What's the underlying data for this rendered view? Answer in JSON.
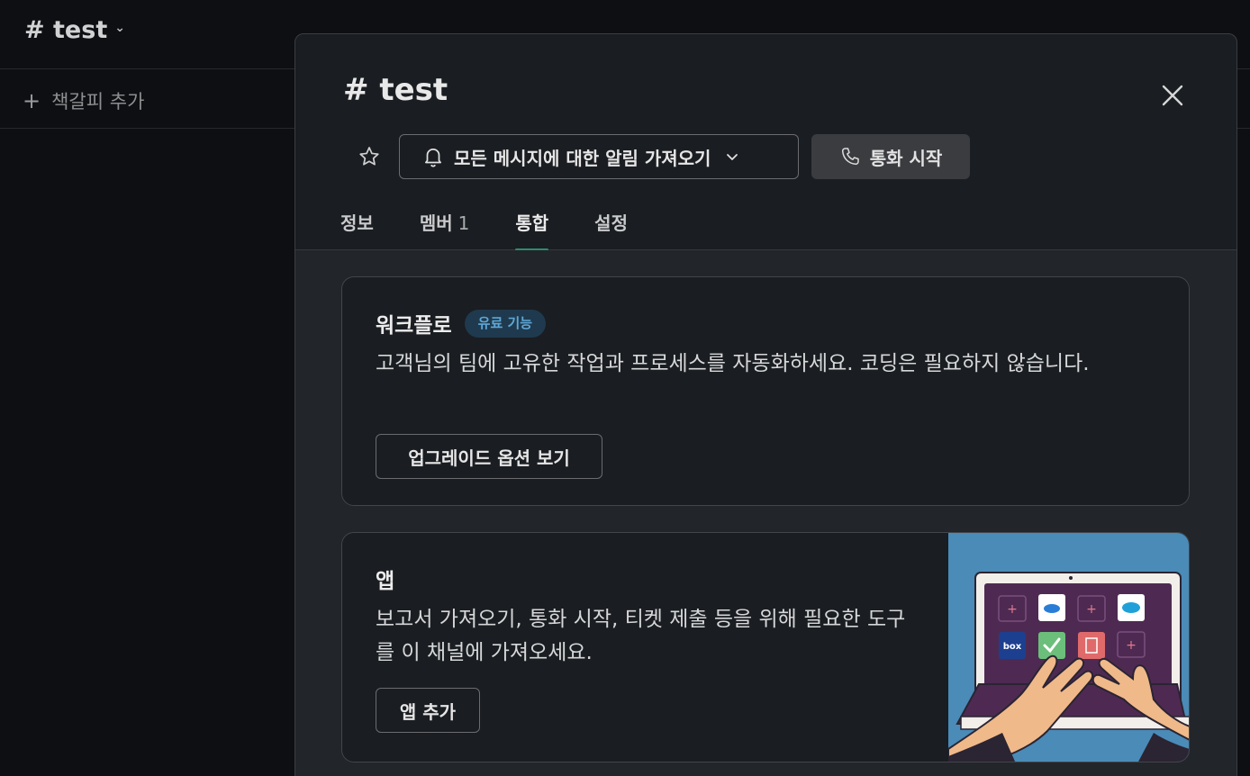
{
  "background": {
    "channel_title": "# test",
    "bookmark_label": "책갈피 추가"
  },
  "dialog": {
    "title": "# test",
    "notification_button": "모든 메시지에 대한 알림 가져오기",
    "call_button": "통화 시작",
    "tabs": [
      {
        "label": "정보",
        "count": ""
      },
      {
        "label": "멤버",
        "count": "1"
      },
      {
        "label": "통합",
        "count": "",
        "active": true
      },
      {
        "label": "설정",
        "count": ""
      }
    ],
    "workflow": {
      "title": "워크플로",
      "badge": "유료 기능",
      "description": "고객님의 팀에 고유한 작업과 프로세스를 자동화하세요. 코딩은 필요하지 않습니다.",
      "button": "업그레이드 옵션 보기"
    },
    "apps": {
      "title": "앱",
      "description": "보고서 가져오기, 통화 시작, 티켓 제출 등을 위해 필요한 도구를 이 채널에 가져오세요.",
      "button": "앱 추가",
      "illustration_labels": [
        "box"
      ]
    }
  },
  "colors": {
    "accent_tab": "#2e8b6e",
    "badge_text": "#5fa7d6",
    "illustration_bg": "#4a8bb8"
  }
}
